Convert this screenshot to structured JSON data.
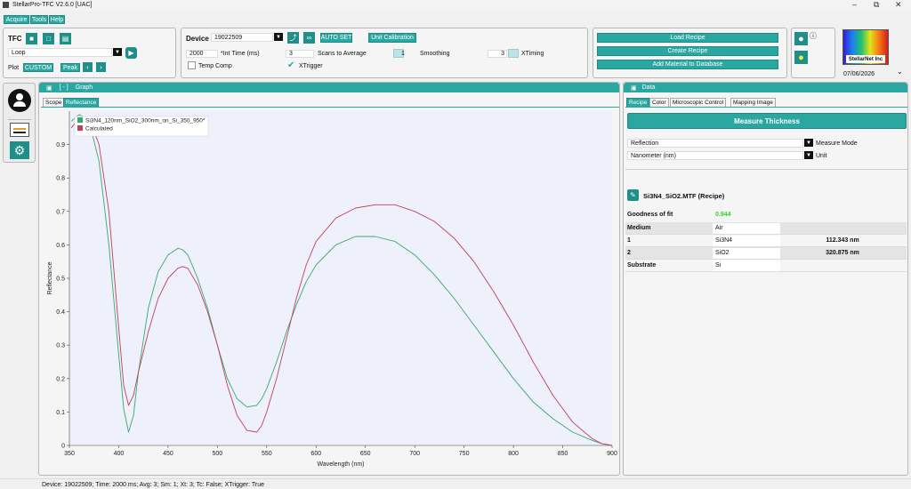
{
  "app": {
    "title": "StellarPro-TFC V2.6.0 [UAC]",
    "min": "–",
    "max": "⧉",
    "close": "✕"
  },
  "menu": [
    "Acquire",
    "Tools",
    "Help"
  ],
  "tfc": {
    "label": "TFC",
    "loop_value": "Loop",
    "plot_label": "Plot",
    "plot_value": "CUSTOM",
    "peak_label": "Peak"
  },
  "device": {
    "label": "Device",
    "id": "19022509",
    "auto_set": "AUTO SET",
    "unit_cal": "Unit Calibration",
    "int_time_value": "2000",
    "int_time_label": "*Int Time (ms)",
    "scans_value": "3",
    "scans_label": "Scans to Average",
    "smoothing_value": "1",
    "smoothing_label": "Smoothing",
    "xtiming_value": "3",
    "xtiming_label": "XTiming",
    "temp_comp": "Temp Comp",
    "xtrigger": "XTrigger"
  },
  "recipe_buttons": {
    "load": "Load Recipe",
    "create": "Create Recipe",
    "add_material": "Add Material to Database"
  },
  "info": "ⓘ",
  "date": "07/06/2026",
  "logo_text": "StellarNet Inc",
  "graph": {
    "header": "Graph",
    "expand": "[ - ]",
    "tabs": [
      "Scope",
      "Reflectance"
    ],
    "active_tab": "Reflectance"
  },
  "data_panel": {
    "header": "Data",
    "tabs": [
      "Recipe",
      "Color",
      "Microscopic Control",
      "Mapping Image"
    ],
    "active_tab": "Recipe",
    "measure": "Measure Thickness",
    "mode_value": "Reflection",
    "mode_label": "Measure Mode",
    "unit_value": "Nanometer (nm)",
    "unit_label": "Unit",
    "recipe_name": "Si3N4_SiO2.MTF (Recipe)",
    "gof_label": "Goodness of fit",
    "gof_value": "0.944",
    "rows": [
      {
        "label": "Medium",
        "material": "Air",
        "thickness": ""
      },
      {
        "label": "1",
        "material": "Si3N4",
        "thickness": "112.343 nm"
      },
      {
        "label": "2",
        "material": "SiO2",
        "thickness": "320.875 nm"
      },
      {
        "label": "Substrate",
        "material": "Si",
        "thickness": ""
      }
    ]
  },
  "status": "Device: 19022509; Time: 2000 ms; Avg: 3; Sm: 1; Xt: 3; Tc: False; XTrigger: True",
  "chart_data": {
    "type": "line",
    "xlabel": "Wavelength (nm)",
    "ylabel": "Reflectance",
    "xlim": [
      350,
      900
    ],
    "ylim": [
      0,
      1
    ],
    "x_ticks": [
      350,
      400,
      450,
      500,
      550,
      600,
      650,
      700,
      750,
      800,
      850,
      900
    ],
    "y_ticks": [
      0,
      0.1,
      0.2,
      0.3,
      0.4,
      0.5,
      0.6,
      0.7,
      0.8,
      0.9
    ],
    "grid": false,
    "legend_position": "top-left",
    "series": [
      {
        "name": "Si3N4_120nm_SiO2_300nm_on_Si_350_950*",
        "color": "#3aa86a",
        "x": [
          352,
          360,
          370,
          380,
          390,
          400,
          405,
          410,
          415,
          420,
          430,
          440,
          450,
          460,
          465,
          470,
          480,
          490,
          500,
          510,
          520,
          530,
          540,
          545,
          550,
          560,
          570,
          580,
          590,
          600,
          620,
          640,
          660,
          680,
          700,
          720,
          740,
          760,
          780,
          800,
          820,
          840,
          860,
          880,
          890,
          900
        ],
        "y": [
          0.97,
          0.99,
          0.97,
          0.85,
          0.6,
          0.27,
          0.11,
          0.04,
          0.09,
          0.22,
          0.41,
          0.52,
          0.57,
          0.59,
          0.585,
          0.57,
          0.5,
          0.41,
          0.3,
          0.2,
          0.14,
          0.115,
          0.12,
          0.14,
          0.17,
          0.25,
          0.34,
          0.42,
          0.49,
          0.54,
          0.6,
          0.625,
          0.625,
          0.61,
          0.57,
          0.51,
          0.44,
          0.36,
          0.28,
          0.2,
          0.13,
          0.08,
          0.04,
          0.015,
          0.005,
          0.0
        ]
      },
      {
        "name": "Calculated",
        "color": "#c0405a",
        "x": [
          352,
          360,
          370,
          380,
          390,
          400,
          405,
          410,
          415,
          420,
          430,
          440,
          450,
          460,
          465,
          470,
          480,
          490,
          500,
          510,
          520,
          530,
          540,
          545,
          550,
          560,
          570,
          580,
          590,
          600,
          620,
          640,
          660,
          680,
          700,
          720,
          740,
          760,
          780,
          800,
          820,
          840,
          860,
          880,
          890,
          900
        ],
        "y": [
          0.95,
          0.98,
          0.98,
          0.9,
          0.7,
          0.35,
          0.18,
          0.12,
          0.15,
          0.22,
          0.34,
          0.44,
          0.5,
          0.53,
          0.535,
          0.53,
          0.48,
          0.4,
          0.3,
          0.18,
          0.09,
          0.045,
          0.04,
          0.06,
          0.1,
          0.2,
          0.32,
          0.44,
          0.54,
          0.61,
          0.68,
          0.71,
          0.72,
          0.72,
          0.7,
          0.67,
          0.62,
          0.55,
          0.46,
          0.36,
          0.25,
          0.15,
          0.07,
          0.02,
          0.005,
          0.0
        ]
      }
    ]
  }
}
